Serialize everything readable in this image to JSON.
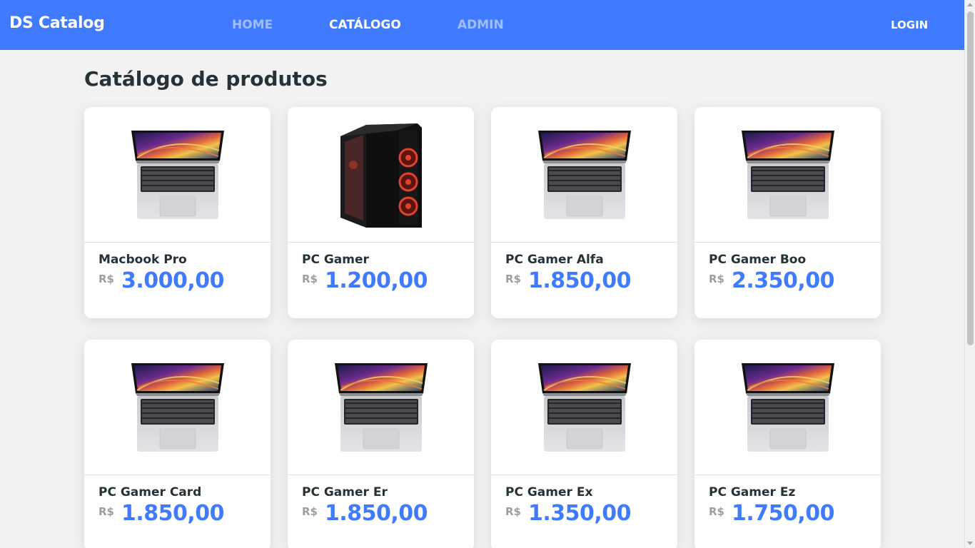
{
  "navbar": {
    "brand": "DS Catalog",
    "links": [
      {
        "label": "HOME",
        "active": false
      },
      {
        "label": "CATÁLOGO",
        "active": true
      },
      {
        "label": "ADMIN",
        "active": false
      }
    ],
    "login": "LOGIN"
  },
  "page": {
    "title": "Catálogo de produtos"
  },
  "products": [
    {
      "name": "Macbook Pro",
      "currency": "R$",
      "price": "3.000,00",
      "image": "laptop"
    },
    {
      "name": "PC Gamer",
      "currency": "R$",
      "price": "1.200,00",
      "image": "desktop-tower"
    },
    {
      "name": "PC Gamer Alfa",
      "currency": "R$",
      "price": "1.850,00",
      "image": "laptop"
    },
    {
      "name": "PC Gamer Boo",
      "currency": "R$",
      "price": "2.350,00",
      "image": "laptop"
    },
    {
      "name": "PC Gamer Card",
      "currency": "R$",
      "price": "1.850,00",
      "image": "laptop"
    },
    {
      "name": "PC Gamer Er",
      "currency": "R$",
      "price": "1.850,00",
      "image": "laptop"
    },
    {
      "name": "PC Gamer Ex",
      "currency": "R$",
      "price": "1.350,00",
      "image": "laptop"
    },
    {
      "name": "PC Gamer Ez",
      "currency": "R$",
      "price": "1.750,00",
      "image": "laptop"
    }
  ],
  "colors": {
    "primary": "#407bff",
    "background": "#f2f2f2",
    "text": "#263238",
    "muted": "#9e9e9e"
  }
}
